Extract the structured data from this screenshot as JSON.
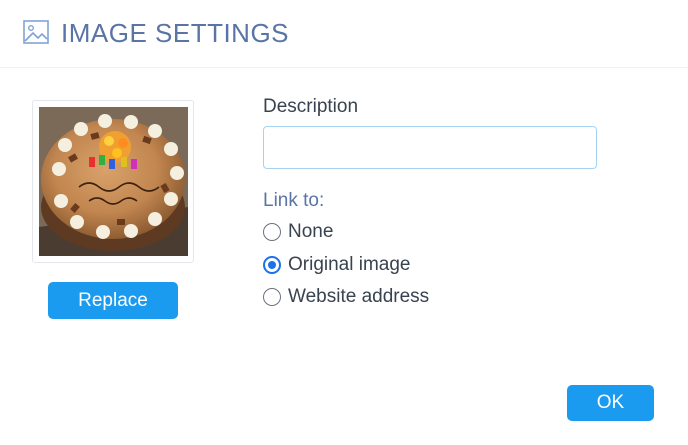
{
  "dialog": {
    "title": "IMAGE SETTINGS",
    "title_icon": "image-icon"
  },
  "image_panel": {
    "thumbnail_subject": "birthday-cake-photo",
    "replace_label": "Replace"
  },
  "form": {
    "description_label": "Description",
    "description_value": "",
    "link_to_label": "Link to:",
    "link_options": [
      {
        "label": "None",
        "checked": false
      },
      {
        "label": "Original image",
        "checked": true
      },
      {
        "label": "Website address",
        "checked": false
      }
    ]
  },
  "footer": {
    "ok_label": "OK"
  },
  "colors": {
    "accent": "#1a9bf0",
    "title": "#5a74a6",
    "radio_selected": "#1a73e8"
  }
}
